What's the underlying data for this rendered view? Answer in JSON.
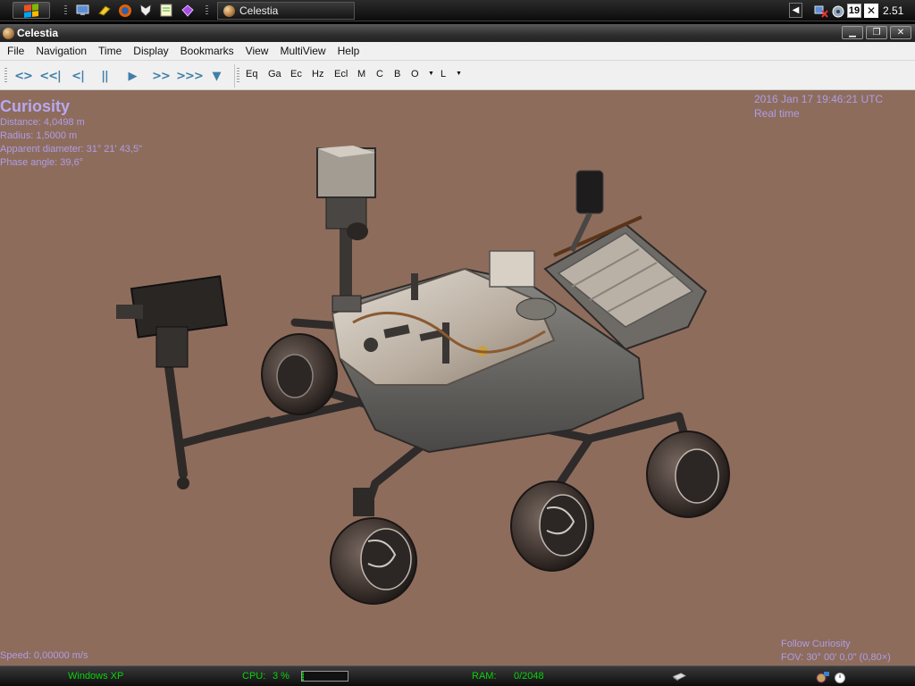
{
  "taskbar": {
    "task_button_label": "Celestia",
    "tray_calendar_day": "19",
    "clock": "2.51",
    "quick_launch_icons": [
      "desktop-icon",
      "eraser-icon",
      "firefox-icon",
      "foxit-icon",
      "notepad-icon",
      "gem-icon"
    ]
  },
  "window": {
    "title": "Celestia",
    "minimize_glyph": "▁",
    "maximize_glyph": "❐",
    "close_glyph": "✕"
  },
  "menu": {
    "items": [
      "File",
      "Navigation",
      "Time",
      "Display",
      "Bookmarks",
      "View",
      "MultiView",
      "Help"
    ]
  },
  "toolbar": {
    "time_buttons": [
      {
        "name": "reverse-time",
        "glyph": "<>"
      },
      {
        "name": "faster-reverse",
        "glyph": "<<|"
      },
      {
        "name": "slower-reverse",
        "glyph": "<|"
      },
      {
        "name": "pause",
        "glyph": "||"
      },
      {
        "name": "play",
        "glyph": "▶"
      },
      {
        "name": "faster",
        "glyph": ">>"
      },
      {
        "name": "much-faster",
        "glyph": ">>>"
      },
      {
        "name": "funnel",
        "glyph": "▼"
      }
    ],
    "render_buttons": [
      "Eq",
      "Ga",
      "Ec",
      "Hz",
      "Ecl",
      "M",
      "C",
      "B",
      "O",
      "L"
    ]
  },
  "hud": {
    "object_name": "Curiosity",
    "distance": "Distance: 4,0498 m",
    "radius": "Radius: 1,5000 m",
    "apparent_diameter": "Apparent diameter: 31° 21' 43,5\"",
    "phase_angle": "Phase angle: 39,6°",
    "datetime": "2016 Jan 17 19:46:21 UTC",
    "time_mode": "Real time",
    "speed": "Speed: 0,00000 m/s",
    "follow": "Follow Curiosity",
    "fov": "FOV: 30° 00' 0,0\" (0,80×)"
  },
  "statusbar": {
    "os": "Windows XP",
    "cpu_label": "CPU:",
    "cpu_value": "3 %",
    "cpu_fraction": 0.03,
    "ram_label": "RAM:",
    "ram_value": "0/2048"
  },
  "colors": {
    "viewport_bg": "#8e6c5c",
    "hud_text": "#ad9de6",
    "status_green": "#0bd10b",
    "toolbar_icon": "#3f7fa8"
  }
}
